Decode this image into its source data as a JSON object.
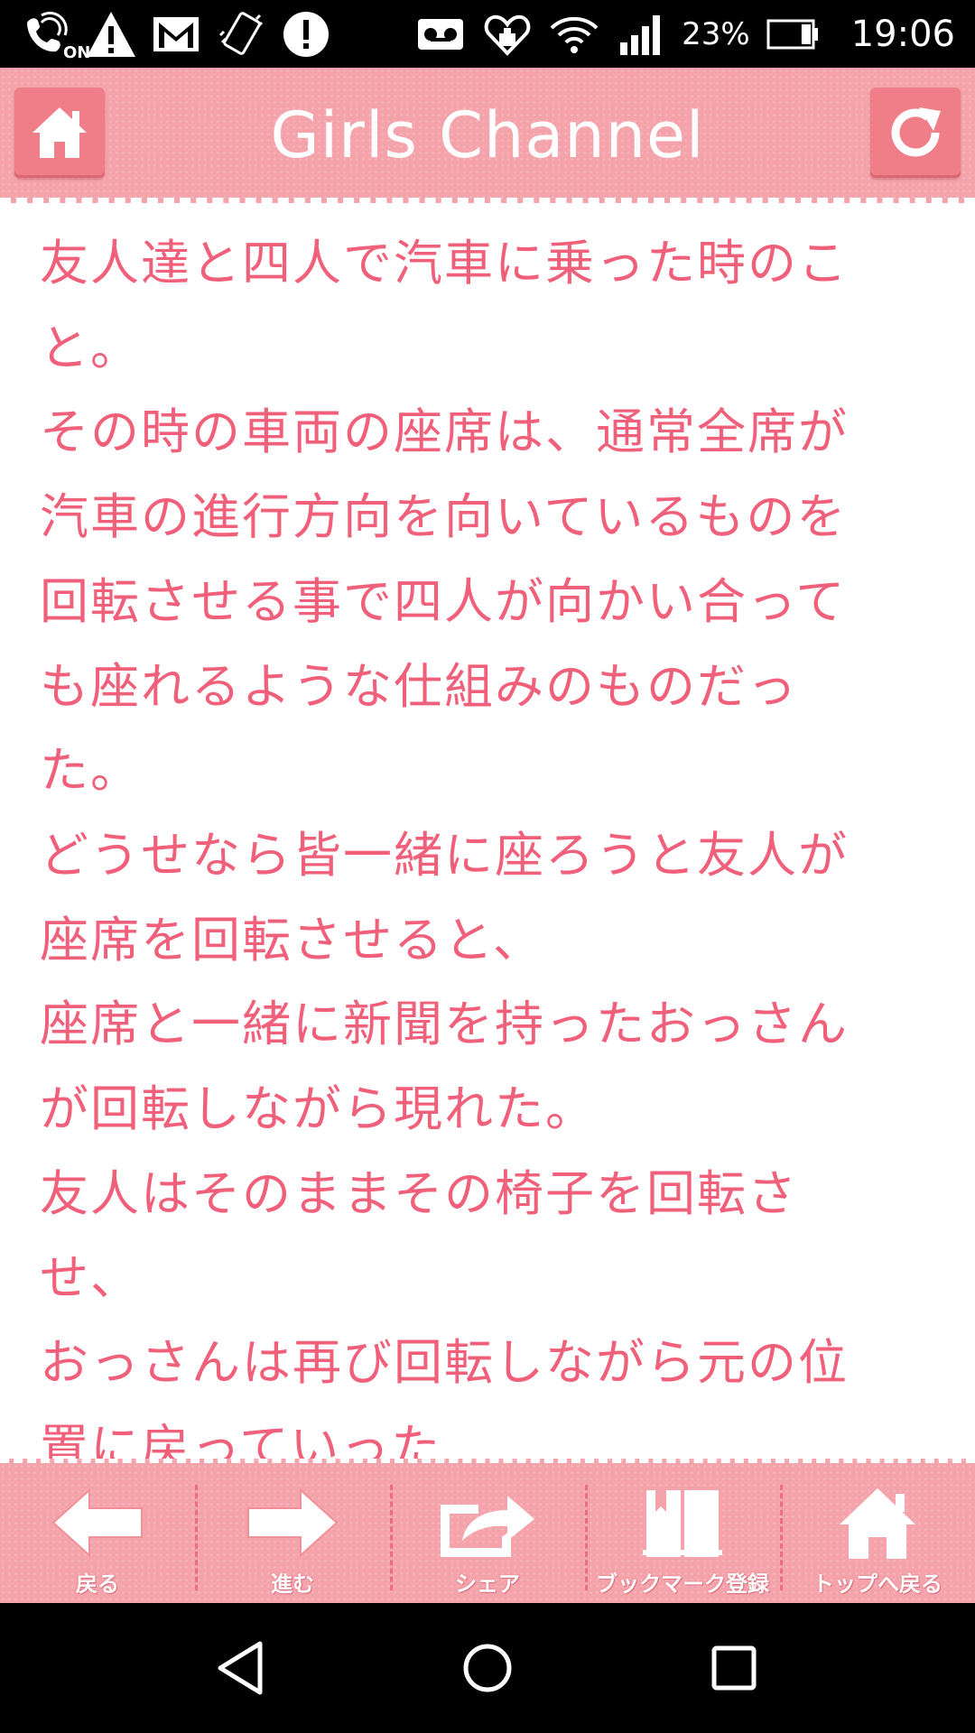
{
  "status_bar": {
    "icons": [
      "wifi-calling-on-icon",
      "warning-icon",
      "gmail-icon",
      "vibrate-icon",
      "alert-circle-icon",
      "voicemail-icon",
      "heart-health-icon",
      "wifi-icon",
      "signal-icon",
      "battery-icon"
    ],
    "wifi_calling_label": "ON",
    "battery_percent": "23%",
    "battery_level": 0.23,
    "time": "19:06"
  },
  "header": {
    "title": "Girls Channel",
    "home_icon": "home-icon",
    "reload_icon": "reload-icon"
  },
  "content": {
    "lines": [
      "友人達と四人で汽車に乗った時のこ",
      "と。",
      "その時の車両の座席は、通常全席が",
      "汽車の進行方向を向いているものを",
      "回転させる事で四人が向かい合って",
      "も座れるような仕組みのものだっ",
      "た。",
      "どうせなら皆一緒に座ろうと友人が",
      "座席を回転させると、",
      "座席と一緒に新聞を持ったおっさん",
      "が回転しながら現れた。",
      "友人はそのままその椅子を回転さ",
      "せ、",
      "おっさんは再び回転しながら元の位",
      "置に戻っていった"
    ]
  },
  "toolbar": {
    "items": [
      {
        "label": "戻る",
        "icon": "arrow-left-icon"
      },
      {
        "label": "進む",
        "icon": "arrow-right-icon"
      },
      {
        "label": "シェア",
        "icon": "share-icon"
      },
      {
        "label": "ブックマーク登録",
        "icon": "bookmark-book-icon"
      },
      {
        "label": "トップへ戻る",
        "icon": "home-icon"
      }
    ]
  },
  "nav_bar": {
    "icons": [
      "back-triangle-icon",
      "home-circle-icon",
      "recents-square-icon"
    ]
  },
  "colors": {
    "header_pink": "#f5a3ab",
    "button_pink": "#f07e88",
    "text_pink": "#f0607a",
    "white": "#ffffff",
    "black": "#000000"
  }
}
